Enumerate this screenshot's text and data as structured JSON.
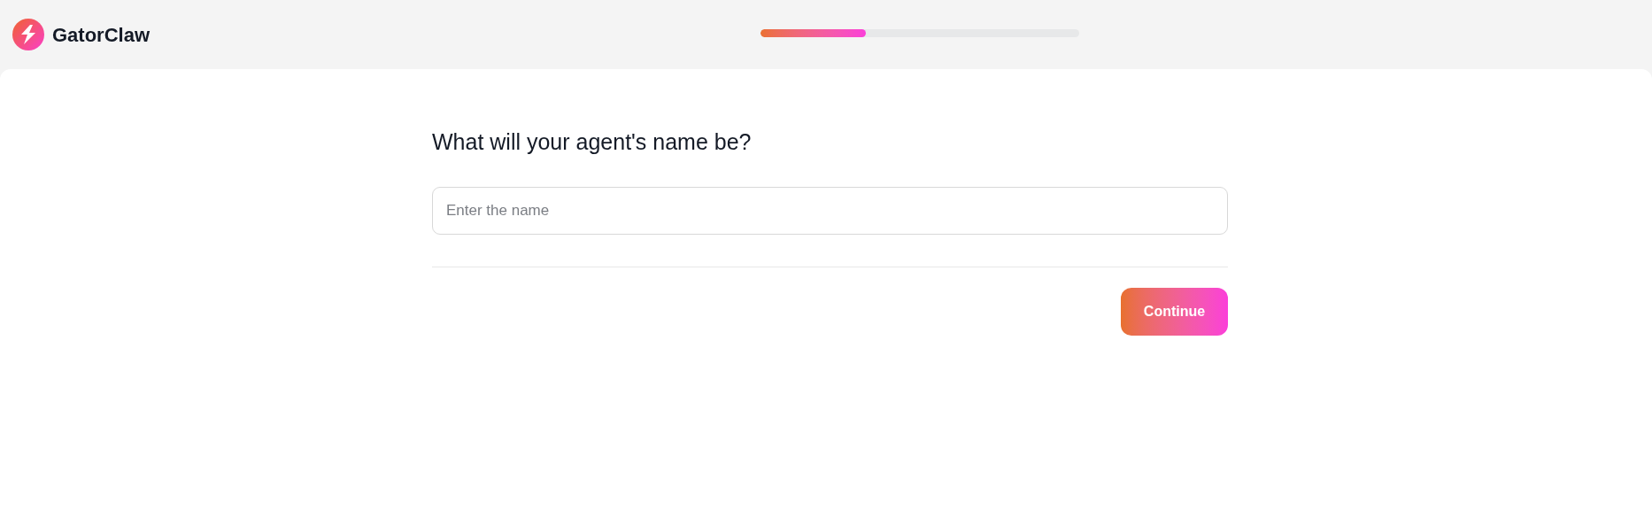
{
  "brand": {
    "name": "GatorClaw"
  },
  "progress": {
    "level": 0.33
  },
  "question": "What will your agent's name be?",
  "name_field": {
    "placeholder": "Enter the name"
  },
  "continue_button": "Continue"
}
